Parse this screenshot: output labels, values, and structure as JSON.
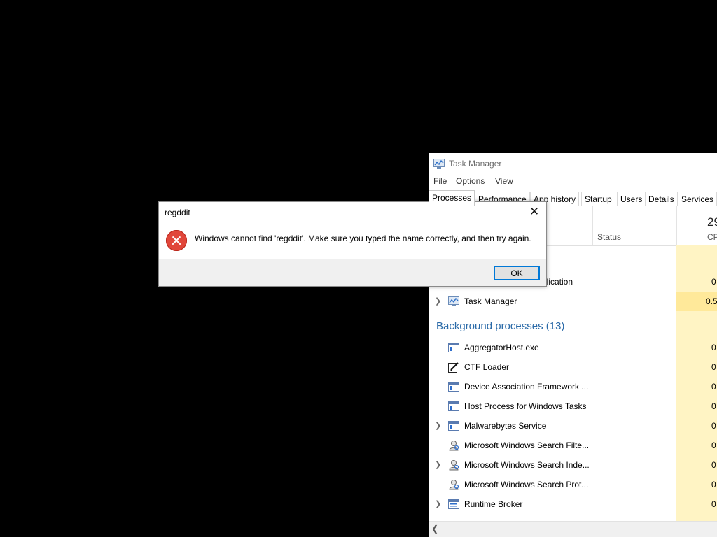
{
  "task_manager": {
    "title": "Task Manager",
    "menu": [
      "File",
      "Options",
      "View"
    ],
    "tabs": [
      "Processes",
      "Performance",
      "App history",
      "Startup",
      "Users",
      "Details",
      "Services"
    ],
    "active_tab": "Processes",
    "header": {
      "status_label": "Status",
      "cpu_percent": "29",
      "cpu_label": "CPU"
    },
    "partial_row_text": "plication",
    "partial_row_cpu": "0",
    "app_rows": [
      {
        "name": "Task Manager",
        "cpu": "0.5",
        "expandable": true,
        "icon": "task-manager-icon"
      }
    ],
    "background_group": {
      "label": "Background processes (13)"
    },
    "background_rows": [
      {
        "name": "AggregatorHost.exe",
        "cpu": "0",
        "expandable": false,
        "icon": "window-icon"
      },
      {
        "name": "CTF Loader",
        "cpu": "0",
        "expandable": false,
        "icon": "pen-icon"
      },
      {
        "name": "Device Association Framework ...",
        "cpu": "0",
        "expandable": false,
        "icon": "window-icon"
      },
      {
        "name": "Host Process for Windows Tasks",
        "cpu": "0",
        "expandable": false,
        "icon": "window-icon"
      },
      {
        "name": "Malwarebytes Service",
        "cpu": "0",
        "expandable": true,
        "icon": "window-icon"
      },
      {
        "name": "Microsoft Windows Search Filte...",
        "cpu": "0",
        "expandable": false,
        "icon": "search-person-icon"
      },
      {
        "name": "Microsoft Windows Search Inde...",
        "cpu": "0",
        "expandable": true,
        "icon": "search-person-icon"
      },
      {
        "name": "Microsoft Windows Search Prot...",
        "cpu": "0",
        "expandable": false,
        "icon": "search-person-icon"
      },
      {
        "name": "Runtime Broker",
        "cpu": "0",
        "expandable": true,
        "icon": "window-icon"
      }
    ]
  },
  "dialog": {
    "title": "regddit",
    "close_glyph": "✕",
    "message": "Windows cannot find 'regddit'. Make sure you typed the name correctly, and then try again.",
    "ok_label": "OK",
    "icon": "error-icon"
  },
  "colors": {
    "cpu_column": "#fff4c4",
    "cpu_column_active": "#ffe99a",
    "group_title": "#2a6aa8",
    "error_red": "#e1463a"
  }
}
